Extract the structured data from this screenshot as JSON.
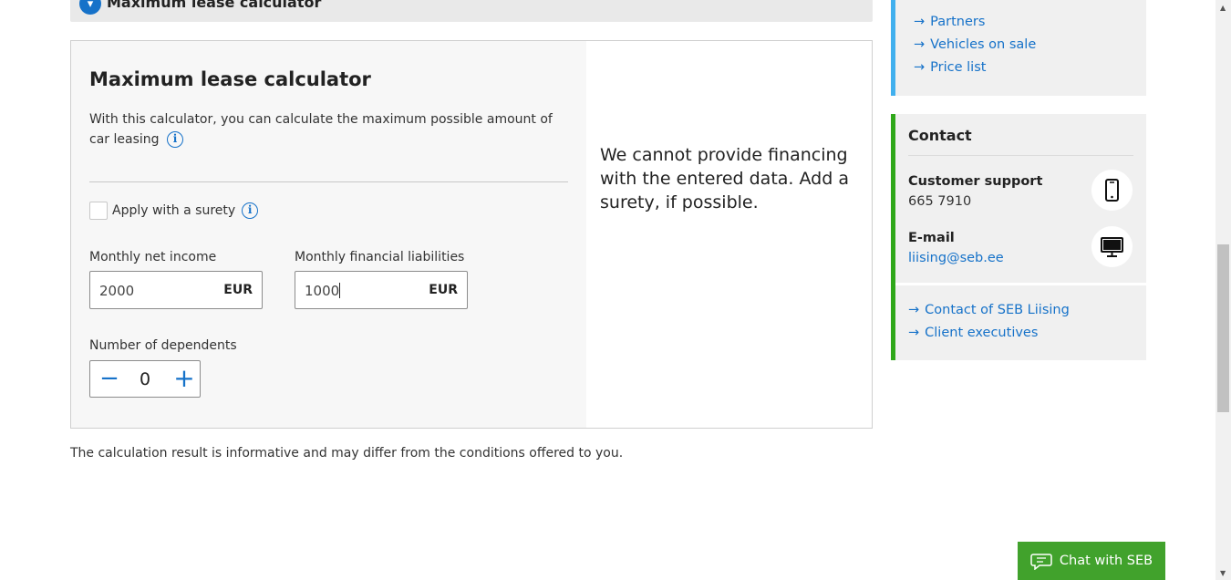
{
  "accordion": {
    "title": "Maximum lease calculator",
    "expand_icon": "chevron-down-icon"
  },
  "calculator": {
    "title": "Maximum lease calculator",
    "description": "With this calculator, you can calculate the maximum possible amount of car leasing",
    "info_icon": "i",
    "surety_label": "Apply with a surety",
    "surety_checked": false,
    "income": {
      "label": "Monthly net income",
      "value": "2000",
      "unit": "EUR"
    },
    "liabilities": {
      "label": "Monthly financial liabilities",
      "value": "1000",
      "unit": "EUR"
    },
    "dependents": {
      "label": "Number of dependents",
      "value": "0",
      "minus": "−",
      "plus": "+"
    },
    "result_message": "We cannot provide financing with the entered data. Add a surety, if possible."
  },
  "disclaimer": "The calculation result is informative and may differ from the conditions offered to you.",
  "sidebar_links": [
    {
      "label": "Partners"
    },
    {
      "label": "Vehicles on sale"
    },
    {
      "label": "Price list"
    }
  ],
  "contact": {
    "title": "Contact",
    "support_label": "Customer support",
    "support_phone": "665 7910",
    "support_icon": "phone-icon",
    "email_label": "E-mail",
    "email": "liising@seb.ee",
    "email_icon": "computer-icon",
    "links": [
      {
        "label": "Contact of SEB Liising"
      },
      {
        "label": "Client executives"
      }
    ]
  },
  "chat": {
    "label": "Chat with SEB",
    "icon": "chat-bubble-icon"
  },
  "colors": {
    "link_blue": "#1672c9",
    "accent_lightblue": "#41b0ee",
    "accent_green": "#2fa81a",
    "chat_green": "#41a22c"
  }
}
